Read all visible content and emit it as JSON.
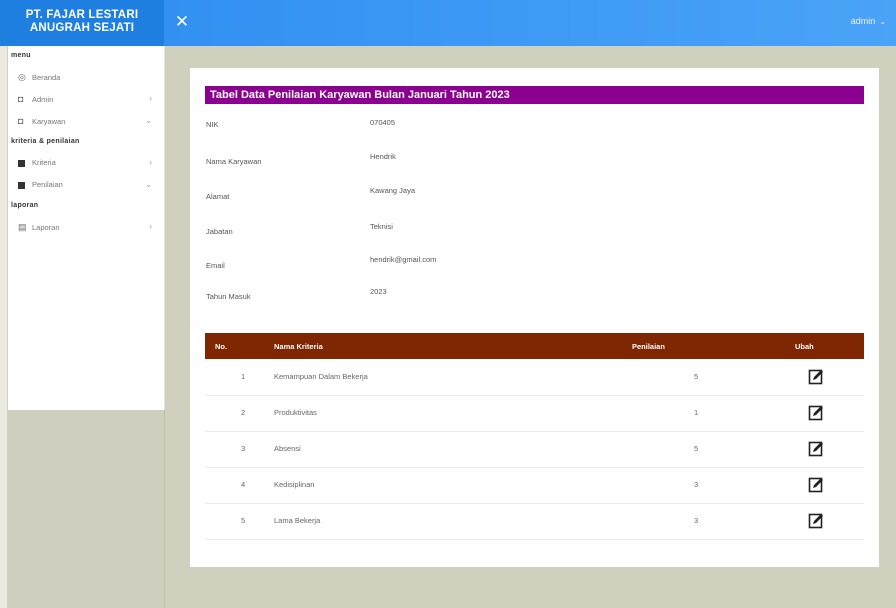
{
  "brand": {
    "line1": "PT. FAJAR LESTARI",
    "line2": "ANUGRAH SEJATI"
  },
  "header": {
    "user_label": "admin"
  },
  "sidebar": {
    "sections": [
      {
        "title": "menu",
        "items": [
          {
            "label": "Beranda",
            "icon": "home-icon"
          },
          {
            "label": "Admin",
            "icon": "user-icon"
          },
          {
            "label": "Karyawan",
            "icon": "users-icon"
          }
        ]
      },
      {
        "title": "kriteria & penilaian",
        "items": [
          {
            "label": "Kriteria",
            "icon": "grid-icon"
          },
          {
            "label": "Penilaian",
            "icon": "grid-icon"
          }
        ]
      },
      {
        "title": "laporan",
        "items": [
          {
            "label": "Laporan",
            "icon": "report-icon"
          }
        ]
      }
    ]
  },
  "main": {
    "title": "Tabel Data Penilaian Karyawan Bulan Januari Tahun 2023",
    "info": [
      {
        "label": "NIK",
        "value": "070405"
      },
      {
        "label": "Nama Karyawan",
        "value": "Hendrik"
      },
      {
        "label": "Alamat",
        "value": "Kawang Jaya"
      },
      {
        "label": "Jabatan",
        "value": "Teknisi"
      },
      {
        "label": "Email",
        "value": "hendrik@gmail.com"
      },
      {
        "label": "Tahun Masuk",
        "value": "2023"
      }
    ],
    "table": {
      "headers": [
        "No.",
        "Nama Kriteria",
        "Penilaian",
        "Ubah"
      ],
      "rows": [
        {
          "no": "1",
          "nama": "Kemampuan Dalam Bekerja",
          "nilai": "5"
        },
        {
          "no": "2",
          "nama": "Produktivitas",
          "nilai": "1"
        },
        {
          "no": "3",
          "nama": "Absensi",
          "nilai": "5"
        },
        {
          "no": "4",
          "nama": "Kedisiplinan",
          "nilai": "3"
        },
        {
          "no": "5",
          "nama": "Lama Bekerja",
          "nilai": "3"
        }
      ]
    }
  }
}
